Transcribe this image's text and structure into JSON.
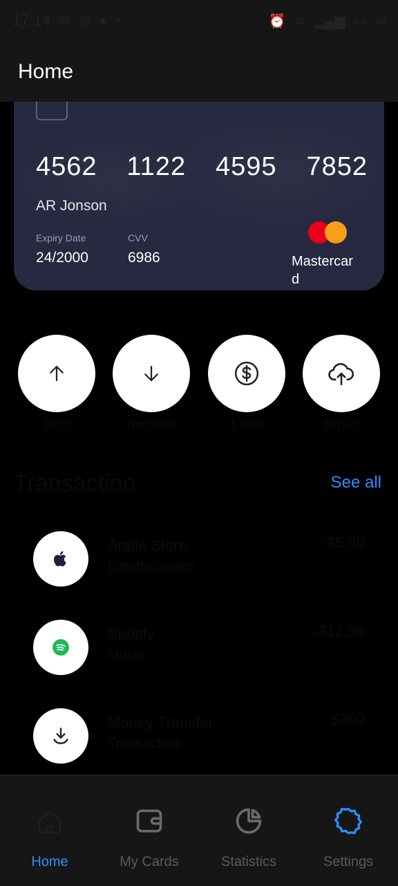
{
  "status_bar": {
    "time": "17:14",
    "battery": "30"
  },
  "app_bar": {
    "title": "Home"
  },
  "card": {
    "number_groups": [
      "4562",
      "1122",
      "4595",
      "7852"
    ],
    "holder": "AR Jonson",
    "expiry_label": "Expiry Date",
    "expiry_value": "24/2000",
    "cvv_label": "CVV",
    "cvv_value": "6986",
    "brand": "Mastercard",
    "brand_colors": {
      "red": "#eb001b",
      "orange": "#f79e1b"
    }
  },
  "actions": [
    {
      "icon": "arrow-up-icon",
      "label": "Sent"
    },
    {
      "icon": "arrow-down-icon",
      "label": "Receive"
    },
    {
      "icon": "dollar-circle-icon",
      "label": "Loan"
    },
    {
      "icon": "cloud-upload-icon",
      "label": "Topup"
    }
  ],
  "transactions": {
    "title": "Transaction",
    "see_all": "See all",
    "items": [
      {
        "icon": "apple-icon",
        "name": "Apple Store",
        "sub": "Entertainment",
        "amount": "-$5,99"
      },
      {
        "icon": "spotify-icon",
        "name": "Spotify",
        "sub": "Music",
        "amount": "-$12,99"
      },
      {
        "icon": "download-icon",
        "name": "Money Transfer",
        "sub": "Transaction",
        "amount": "$300"
      }
    ]
  },
  "bottom_nav": {
    "items": [
      {
        "label": "Home",
        "icon": "home-icon",
        "active": true
      },
      {
        "label": "My Cards",
        "icon": "wallet-icon",
        "active": false
      },
      {
        "label": "Statistics",
        "icon": "pie-chart-icon",
        "active": false
      },
      {
        "label": "Settings",
        "icon": "gear-icon",
        "active": true
      }
    ]
  },
  "colors": {
    "accent": "#2f8cff",
    "card_bg": "#26293f",
    "app_bg": "#000000"
  }
}
